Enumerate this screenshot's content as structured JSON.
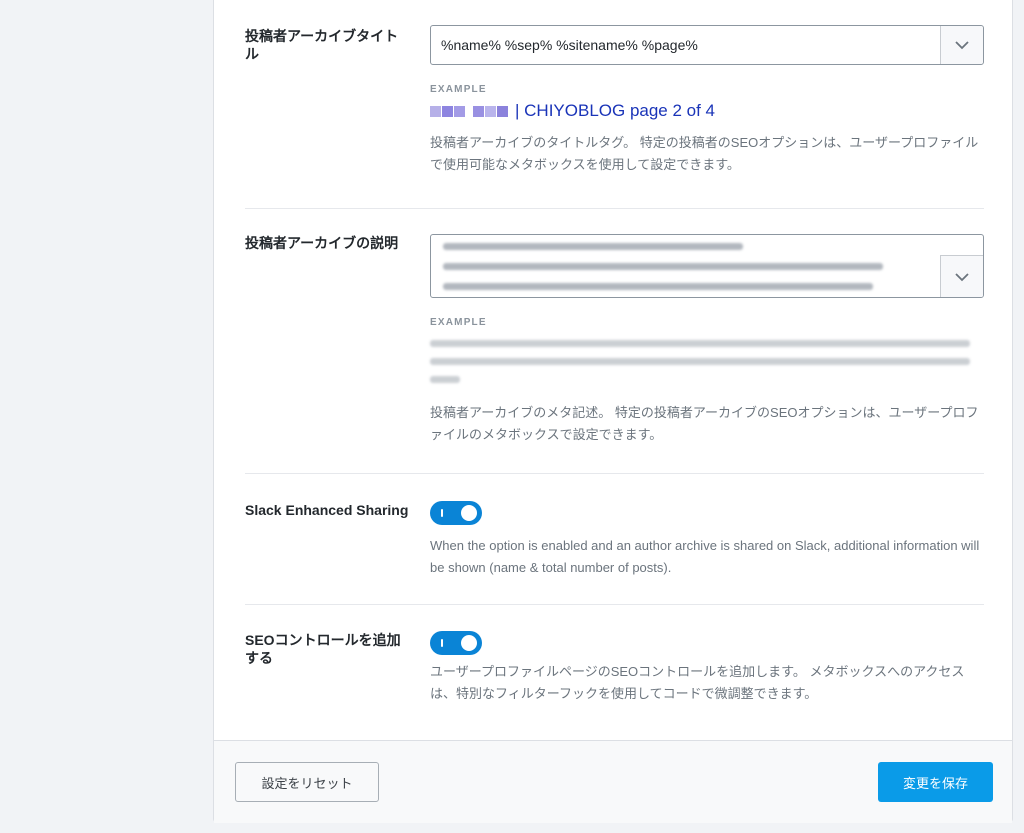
{
  "author_title": {
    "label": "投稿者アーカイブタイトル",
    "value": "%name% %sep% %sitename% %page%",
    "example_label": "EXAMPLE",
    "example_text": "| CHIYOBLOG page 2 of 4",
    "help": "投稿者アーカイブのタイトルタグ。 特定の投稿者のSEOオプションは、ユーザープロファイルで使用可能なメタボックスを使用して設定できます。"
  },
  "author_desc": {
    "label": "投稿者アーカイブの説明",
    "example_label": "EXAMPLE",
    "help": "投稿者アーカイブのメタ記述。 特定の投稿者アーカイブのSEOオプションは、ユーザープロファイルのメタボックスで設定できます。"
  },
  "slack": {
    "label": "Slack Enhanced Sharing",
    "enabled": true,
    "help": "When the option is enabled and an author archive is shared on Slack, additional information will be shown (name & total number of posts)."
  },
  "seo_controls": {
    "label": "SEOコントロールを追加する",
    "enabled": true,
    "help": "ユーザープロファイルページのSEOコントロールを追加します。 メタボックスへのアクセスは、特別なフィルターフックを使用してコードで微調整できます。"
  },
  "footer": {
    "reset_label": "設定をリセット",
    "save_label": "変更を保存"
  },
  "colors": {
    "accent": "#0a84d6",
    "save": "#0a9be8",
    "link": "#1a34b8"
  },
  "icons": {
    "select_chevron": "chevron-down-icon"
  }
}
